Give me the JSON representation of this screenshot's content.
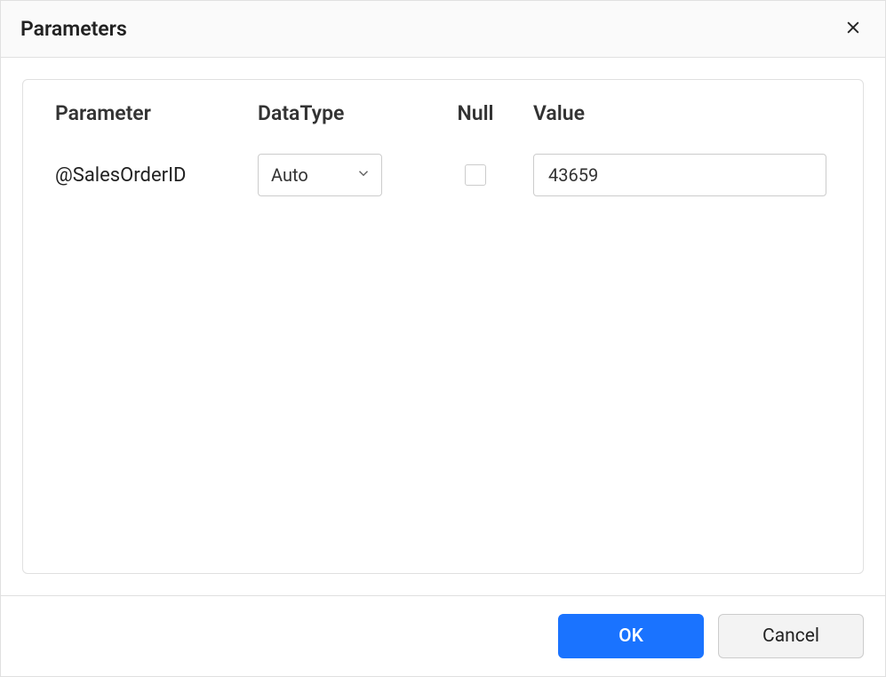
{
  "dialog": {
    "title": "Parameters"
  },
  "columns": {
    "parameter": "Parameter",
    "datatype": "DataType",
    "null": "Null",
    "value": "Value"
  },
  "rows": [
    {
      "name": "@SalesOrderID",
      "datatype": "Auto",
      "null_checked": false,
      "value": "43659"
    }
  ],
  "footer": {
    "ok": "OK",
    "cancel": "Cancel"
  }
}
